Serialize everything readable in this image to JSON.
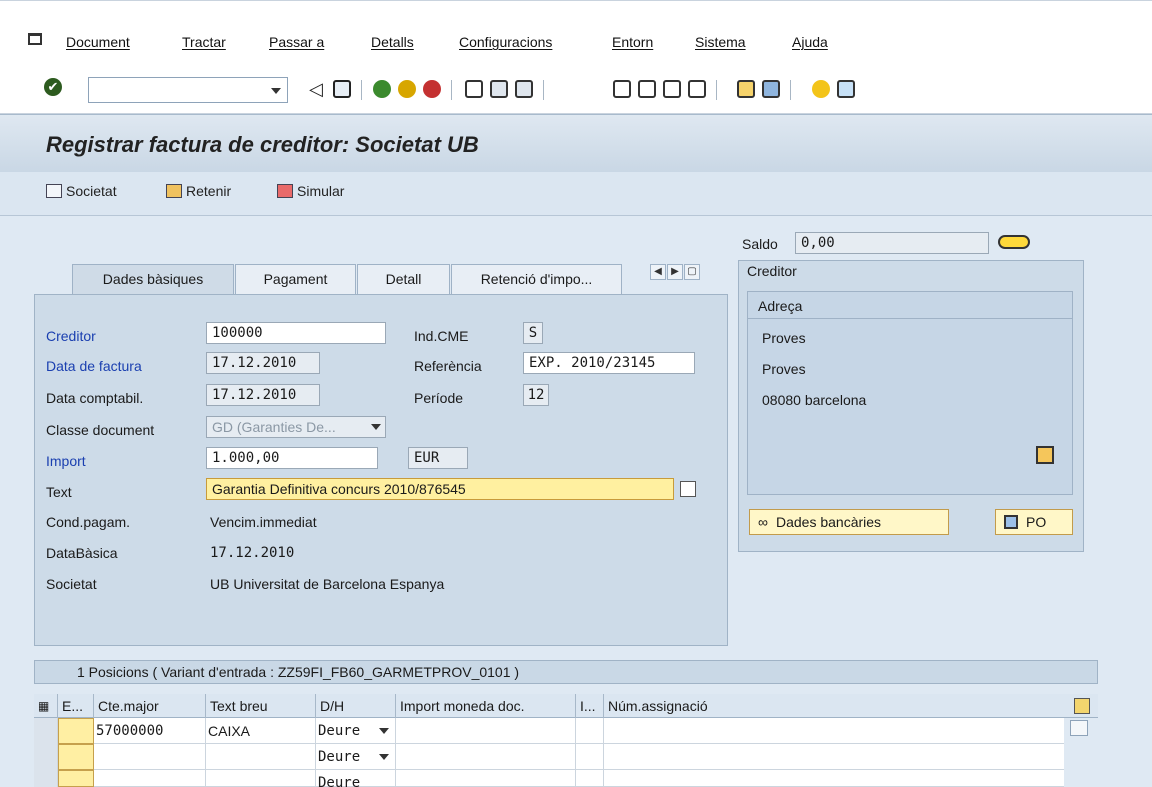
{
  "menu": [
    "Document",
    "Tractar",
    "Passar a",
    "Detalls",
    "Configuracions",
    "Entorn",
    "Sistema",
    "Ajuda"
  ],
  "title": "Registrar factura de creditor: Societat UB",
  "app_toolbar": {
    "societat": "Societat",
    "retenir": "Retenir",
    "simular": "Simular"
  },
  "saldo": {
    "label": "Saldo",
    "value": "0,00"
  },
  "tabs": [
    "Dades bàsiques",
    "Pagament",
    "Detall",
    "Retenció d'impo..."
  ],
  "form": {
    "creditor_label": "Creditor",
    "creditor_value": "100000",
    "ind_cme_label": "Ind.CME",
    "ind_cme_value": "S",
    "data_factura_label": "Data de factura",
    "data_factura_value": "17.12.2010",
    "referencia_label": "Referència",
    "referencia_value": "EXP. 2010/23145",
    "data_comptabil_label": "Data comptabil.",
    "data_comptabil_value": "17.12.2010",
    "periode_label": "Període",
    "periode_value": "12",
    "classe_doc_label": "Classe document",
    "classe_doc_value": "GD (Garanties De...",
    "import_label": "Import",
    "import_value": "1.000,00",
    "currency": "EUR",
    "text_label": "Text",
    "text_value": "Garantia Definitiva concurs 2010/876545",
    "cond_pagam_label": "Cond.pagam.",
    "cond_pagam_value": "Vencim.immediat",
    "databasica_label": "DataBàsica",
    "databasica_value": "17.12.2010",
    "societat_label": "Societat",
    "societat_value": "UB Universitat de Barcelona Espanya"
  },
  "creditor_panel": {
    "title": "Creditor",
    "address_title": "Adreça",
    "address_lines": [
      "Proves",
      "Proves",
      "08080 barcelona"
    ],
    "bank_button": "Dades bancàries",
    "po_button": "PO"
  },
  "grid": {
    "header": "1 Posicions ( Variant d'entrada : ZZ59FI_FB60_GARMETPROV_0101 )",
    "columns": [
      "E...",
      "Cte.major",
      "Text breu",
      "D/H",
      "Import moneda doc.",
      "I...",
      "Núm.assignació"
    ],
    "rows": [
      {
        "cte_major": "57000000",
        "text_breu": "CAIXA",
        "dh": "Deure"
      },
      {
        "cte_major": "",
        "text_breu": "",
        "dh": "Deure"
      },
      {
        "cte_major": "",
        "text_breu": "",
        "dh": "Deure"
      }
    ]
  }
}
